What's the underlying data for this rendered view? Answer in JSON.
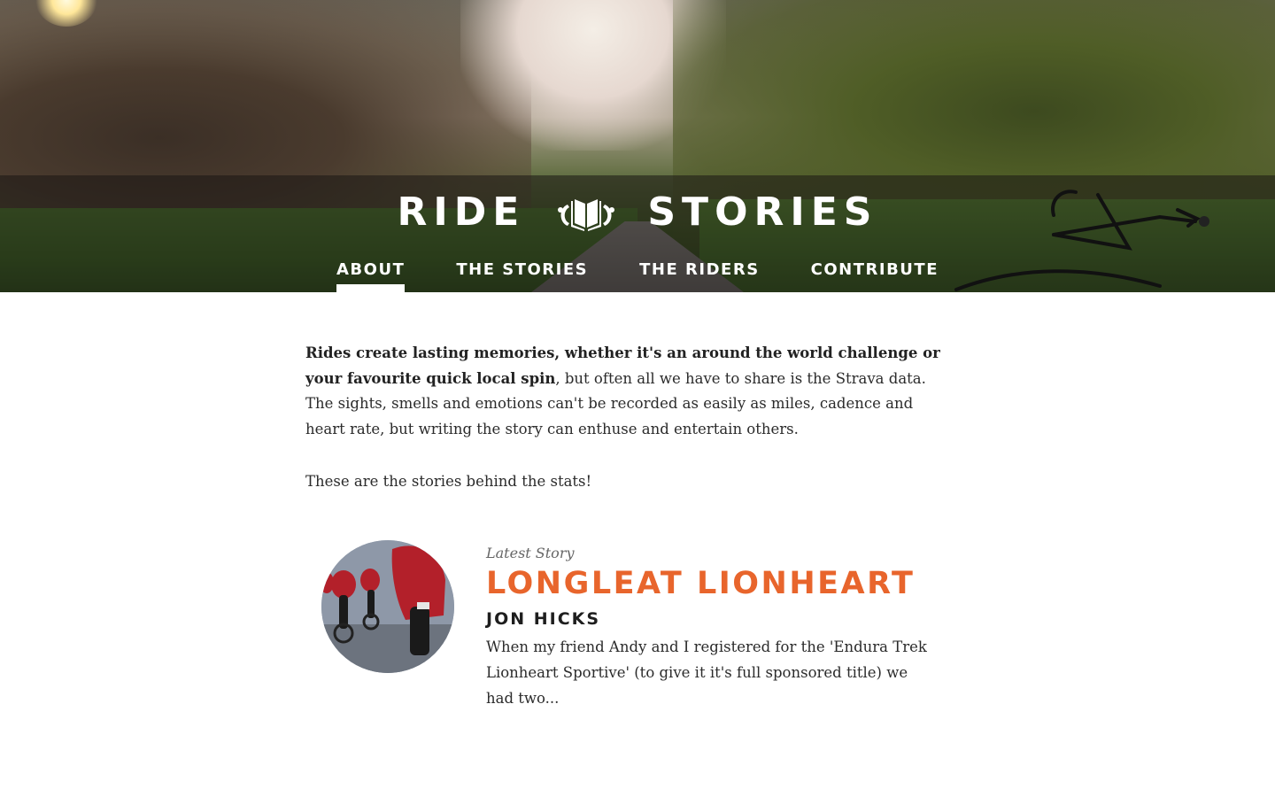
{
  "site": {
    "title_left": "RIDE",
    "title_right": "STORIES",
    "logo_icon": "open-book-icon"
  },
  "nav": {
    "items": [
      {
        "label": "ABOUT",
        "active": true
      },
      {
        "label": "THE STORIES",
        "active": false
      },
      {
        "label": "THE RIDERS",
        "active": false
      },
      {
        "label": "CONTRIBUTE",
        "active": false
      }
    ]
  },
  "intro": {
    "bold_lead": "Rides create lasting memories, whether it's an around the world challenge or your favourite quick local spin",
    "rest": ", but often all we have to share is the Strava data. The sights, smells and emotions can't be recorded as easily as miles, cadence and heart rate, but writing the story can enthuse and entertain others.",
    "tagline": "These are the stories behind the stats!"
  },
  "latest_story": {
    "label": "Latest Story",
    "title": "LONGLEAT LIONHEART",
    "author": "JON HICKS",
    "excerpt": "When my friend Andy and I registered for the 'Endura Trek Lionheart Sportive' (to give it it's full sponsored title) we had two..."
  },
  "colors": {
    "accent": "#e8652c",
    "text": "#2b2b2b",
    "nav_text": "#ffffff"
  }
}
